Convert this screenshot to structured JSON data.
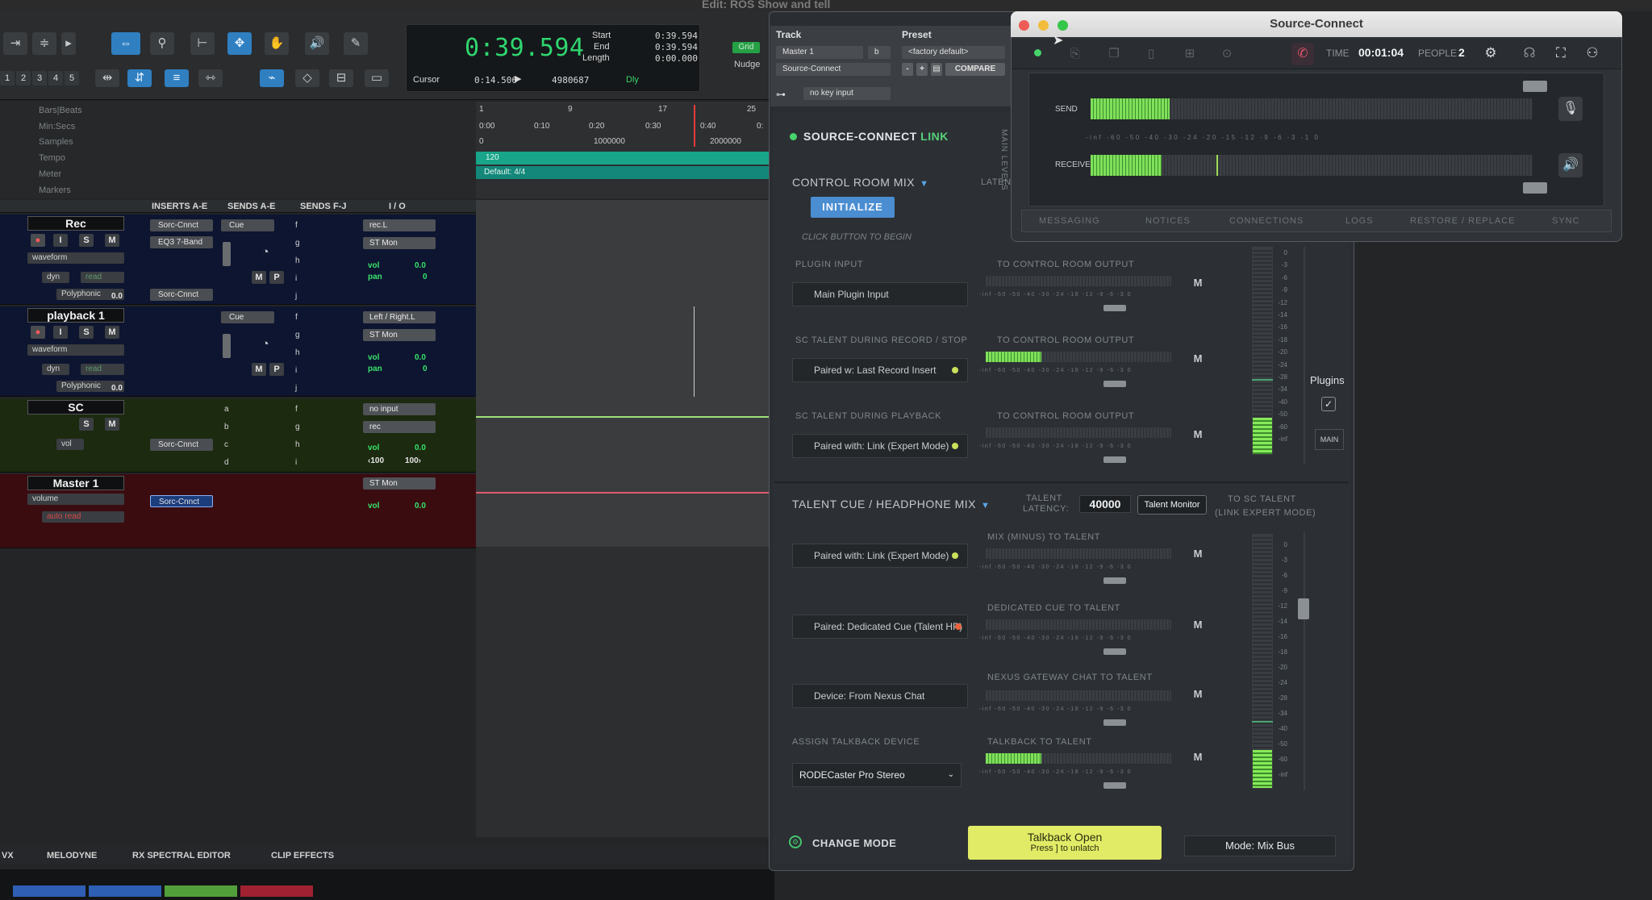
{
  "protools": {
    "window_title": "Edit: ROS Show and tell",
    "counter": {
      "main": "0:39.594",
      "start_label": "Start",
      "start_value": "0:39.594",
      "end_label": "End",
      "end_value": "0:39.594",
      "length_label": "Length",
      "length_value": "0:00.000",
      "cursor_label": "Cursor",
      "cursor_value": "0:14.506",
      "samples_value": "4980687",
      "dly_label": "Dly",
      "grid_label": "Grid",
      "nudge_label": "Nudge"
    },
    "zoom_presets": [
      "1",
      "2",
      "3",
      "4",
      "5"
    ],
    "rulers": [
      "Bars|Beats",
      "Min:Secs",
      "Samples",
      "Tempo",
      "Meter",
      "Markers"
    ],
    "bar_ticks": [
      "1",
      "9",
      "17",
      "25"
    ],
    "min_ticks": [
      "0:00",
      "0:10",
      "0:20",
      "0:30",
      "0:40",
      "0:"
    ],
    "sample_ticks": [
      "0",
      "1000000",
      "2000000"
    ],
    "tempo_value": "120",
    "meter_value": "Default: 4/4",
    "mix_headers": [
      "INSERTS A-E",
      "SENDS A-E",
      "SENDS F-J",
      "I / O"
    ],
    "tracks": [
      {
        "name": "Rec",
        "view": "waveform",
        "dyn": "dyn",
        "auto": "read",
        "mode": "Polyphonic",
        "db": "0.0",
        "inserts": [
          "Sorc-Cnnct",
          "EQ3 7-Band",
          "",
          "",
          "Sorc-Cnnct"
        ],
        "send_a": "Cue",
        "send_letters": [
          "f",
          "g",
          "h",
          "i",
          "j"
        ],
        "io_input": "rec.L",
        "io_output": "ST Mon",
        "vol_label": "vol",
        "vol": "0.0",
        "pan_label": "pan",
        "pan": "0"
      },
      {
        "name": "playback 1",
        "view": "waveform",
        "dyn": "dyn",
        "auto": "read",
        "mode": "Polyphonic",
        "db": "0.0",
        "inserts": [
          "",
          "",
          "",
          "",
          ""
        ],
        "send_a": "Cue",
        "send_letters": [
          "f",
          "g",
          "h",
          "i",
          "j"
        ],
        "io_input": "Left / Right.L",
        "io_output": "ST Mon",
        "vol_label": "vol",
        "vol": "0.0",
        "pan_label": "pan",
        "pan": "0"
      },
      {
        "name": "SC",
        "vol_ctrl": "vol",
        "inserts": [
          "",
          "",
          "Sorc-Cnnct",
          ""
        ],
        "send_letters": [
          "a",
          "b",
          "c",
          "d"
        ],
        "send_letters_2": [
          "f",
          "g",
          "h",
          "i"
        ],
        "io_input": "no input",
        "io_output": "rec",
        "vol_label": "vol",
        "vol": "0.0",
        "pan_l": "‹100",
        "pan_r": "100›"
      },
      {
        "name": "Master 1",
        "view": "volume",
        "auto": "auto read",
        "insert": "Sorc-Cnnct",
        "io_output": "ST Mon",
        "vol_label": "vol",
        "vol": "0.0"
      }
    ],
    "bottom_tabs": [
      "VX",
      "MELODYNE",
      "RX SPECTRAL EDITOR",
      "CLIP EFFECTS"
    ]
  },
  "plugin": {
    "track_label": "Track",
    "preset_label": "Preset",
    "track_select": "Master 1",
    "track_channel": "b",
    "preset_select": "<factory default>",
    "insert_select": "Source-Connect",
    "compare_label": "COMPARE",
    "key_input": "no key input",
    "title_prefix": "SOURCE-CONNECT ",
    "title_suffix": "LINK",
    "control_room": {
      "title": "CONTROL ROOM MIX",
      "latency_partial": "LATEN",
      "initialize_label": "INITIALIZE",
      "hint": "CLICK BUTTON TO BEGIN",
      "rows": [
        {
          "section": "PLUGIN INPUT",
          "source": "Main Plugin Input",
          "dest": "TO CONTROL ROOM OUTPUT",
          "led": "",
          "level": 0.0
        },
        {
          "section": "SC TALENT DURING RECORD / STOP",
          "source": "Paired w: Last Record Insert",
          "dest": "TO CONTROL ROOM OUTPUT",
          "led": "#c9e05a",
          "level": 0.3
        },
        {
          "section": "SC TALENT DURING PLAYBACK",
          "source": "Paired with: Link (Expert Mode)",
          "dest": "TO CONTROL ROOM OUTPUT",
          "led": "#c9e05a",
          "level": 0.0
        }
      ]
    },
    "talent_cue": {
      "title": "TALENT CUE / HEADPHONE MIX",
      "latency_label_1": "TALENT",
      "latency_label_2": "LATENCY:",
      "latency_value": "40000",
      "talent_monitor_label": "Talent Monitor",
      "to_sc_label_1": "TO SC TALENT",
      "to_sc_label_2": "(LINK EXPERT MODE)",
      "rows": [
        {
          "section": "",
          "source": "Paired with: Link (Expert Mode)",
          "dest": "MIX (MINUS) TO TALENT",
          "led": "#c9e05a",
          "level": 0.0
        },
        {
          "section": "",
          "source": "Paired: Dedicated Cue (Talent HP)",
          "dest": "DEDICATED CUE TO TALENT",
          "led": "#e8643e",
          "level": 0.0
        },
        {
          "section": "",
          "source": "Device: From Nexus Chat",
          "dest": "NEXUS GATEWAY CHAT TO TALENT",
          "led": "",
          "level": 0.0
        },
        {
          "section": "ASSIGN TALKBACK  DEVICE",
          "source": "",
          "dest": "TALKBACK TO TALENT",
          "led": "",
          "level": 0.3
        }
      ],
      "talkback_device": "RODECaster Pro Stereo"
    },
    "meter_scale": [
      "-inf",
      "-60",
      "-50",
      "-40",
      "-30",
      "-24",
      "-18",
      "-12",
      "-9",
      "-6",
      "-3",
      "0"
    ],
    "vmeter_scale": [
      "0",
      "-3",
      "-6",
      "-9",
      "-12",
      "-14",
      "-16",
      "-18",
      "-20",
      "-24",
      "-28",
      "-34",
      "-40",
      "-50",
      "-60",
      "-inf"
    ],
    "mute_label": "M",
    "plugins_label": "Plugins",
    "main_label": "MAIN",
    "change_mode_label": "CHANGE MODE",
    "talkback_open_label": "Talkback Open",
    "talkback_sub_label": "Press ] to unlatch",
    "mode_label": "Mode: Mix Bus"
  },
  "sc_window": {
    "title": "Source-Connect",
    "time_label": "TIME",
    "time_value": "00:01:04",
    "people_label": "PEOPLE",
    "people_value": "2",
    "main_levels_label": "MAIN LEVELS",
    "send_label": "SEND",
    "receive_label": "RECEIVE",
    "send_level": 0.2,
    "receive_level": 0.15,
    "level_scale": [
      "-inf",
      "-60",
      "-50",
      "-40",
      "-30",
      "-24",
      "-20",
      "-15",
      "-12",
      "-9",
      "-6",
      "-3",
      "-1",
      "0"
    ],
    "tabs": [
      "MESSAGING",
      "NOTICES",
      "CONNECTIONS",
      "LOGS",
      "RESTORE / REPLACE",
      "SYNC"
    ],
    "accent_red": "#e5546a",
    "meter_green": "#7fe05b"
  }
}
